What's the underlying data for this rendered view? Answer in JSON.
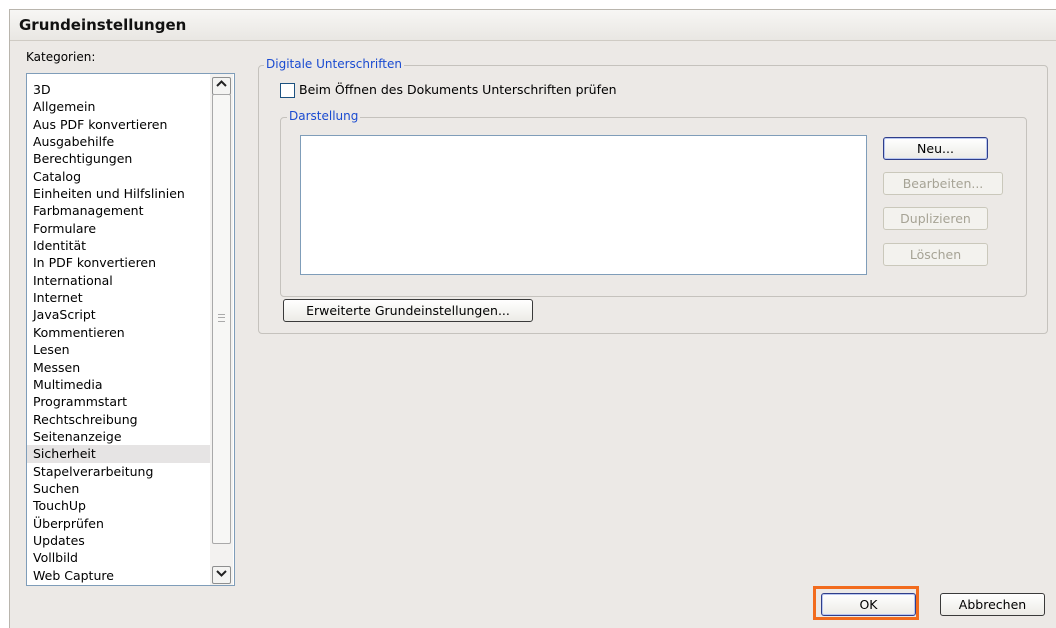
{
  "dialog": {
    "title": "Grundeinstellungen"
  },
  "categories": {
    "label": "Kategorien:",
    "items": [
      "3D",
      "Allgemein",
      "Aus PDF konvertieren",
      "Ausgabehilfe",
      "Berechtigungen",
      "Catalog",
      "Einheiten und Hilfslinien",
      "Farbmanagement",
      "Formulare",
      "Identität",
      "In PDF konvertieren",
      "International",
      "Internet",
      "JavaScript",
      "Kommentieren",
      "Lesen",
      "Messen",
      "Multimedia",
      "Programmstart",
      "Rechtschreibung",
      "Seitenanzeige",
      "Sicherheit",
      "Stapelverarbeitung",
      "Suchen",
      "TouchUp",
      "Überprüfen",
      "Updates",
      "Vollbild",
      "Web Capture"
    ],
    "selected": "Sicherheit"
  },
  "signatures": {
    "group_label": "Digitale Unterschriften",
    "checkbox_label": "Beim Öffnen des Dokuments Unterschriften prüfen",
    "checkbox_checked": false,
    "appearance": {
      "group_label": "Darstellung",
      "new_label": "Neu...",
      "edit_label": "Bearbeiten...",
      "duplicate_label": "Duplizieren",
      "delete_label": "Löschen"
    },
    "advanced_label": "Erweiterte Grundeinstellungen..."
  },
  "footer": {
    "ok_label": "OK",
    "cancel_label": "Abbrechen"
  },
  "colors": {
    "group_legend": "#1a4bd1",
    "highlight": "#f26b1d",
    "selection": "#e6e4e4"
  },
  "icons": {
    "scroll_up": "chevron-up-icon",
    "scroll_down": "chevron-down-icon"
  }
}
